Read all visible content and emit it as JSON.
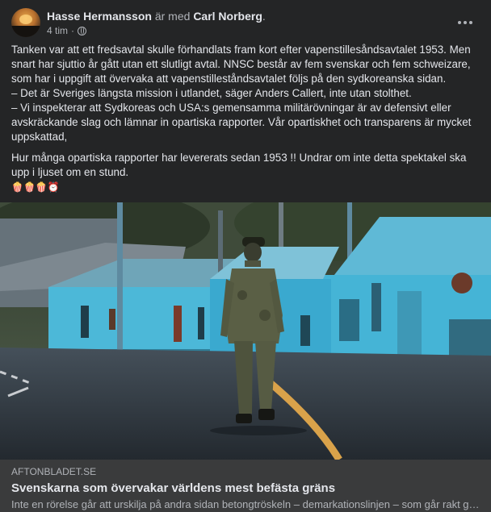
{
  "post": {
    "author": "Hasse Hermansson",
    "with_text": "är med",
    "tagged": "Carl Norberg",
    "period": ".",
    "time": "4 tim",
    "dot": "·",
    "icons": {
      "more": "more-options-icon",
      "privacy": "globe-icon"
    },
    "paragraphs": [
      "Tanken var att ett fredsavtal skulle förhandlats fram kort efter vapenstillesåndsavtalet 1953. Men snart har sjuttio år gått utan ett slutligt avtal. NNSC består av fem svenskar och fem schweizare, som har i uppgift att övervaka att vapenstilleståndsavtalet följs på den sydkoreanska sidan.",
      "– Det är Sveriges längsta mission i utlandet, säger Anders Callert, inte utan stolthet.",
      "– Vi inspekterar att Sydkoreas och USA:s gemensamma militärövningar är av defensivt eller avskräckande slag och lämnar in opartiska rapporter. Vår opartiskhet och transparens är mycket uppskattad,"
    ],
    "question": "Hur många opartiska rapporter har levererats sedan 1953 !! Undrar om inte detta spektakel ska upp i ljuset om en stund.",
    "emojis": "🍿🍿🍿⏰"
  },
  "link": {
    "domain": "AFTONBLADET.SE",
    "title": "Svenskarna som övervakar världens mest befästa gräns",
    "description": "Inte en rörelse går att urskilja på andra sidan betongtröskeln – demarkationslinjen – som går rakt genom området."
  },
  "colors": {
    "background": "#242526",
    "link_box": "#3a3b3c",
    "primary_text": "#e4e6eb",
    "secondary_text": "#b0b3b8",
    "building_blue": "#4cb8d8"
  }
}
